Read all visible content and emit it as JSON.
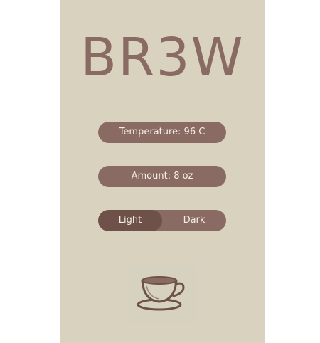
{
  "app": {
    "logo_text": "BR3W"
  },
  "controls": {
    "temperature_label": "Temperature: 96 C",
    "amount_label": "Amount: 8 oz",
    "strength_options": [
      "Light",
      "Dark"
    ],
    "strength_selected": "Light"
  },
  "icons": {
    "cup": "coffee-cup-icon"
  },
  "colors": {
    "panel_bg": "#d9d2bf",
    "accent": "#8a6b63",
    "accent_dark": "#6e5249",
    "text_light": "#f4efe6"
  }
}
